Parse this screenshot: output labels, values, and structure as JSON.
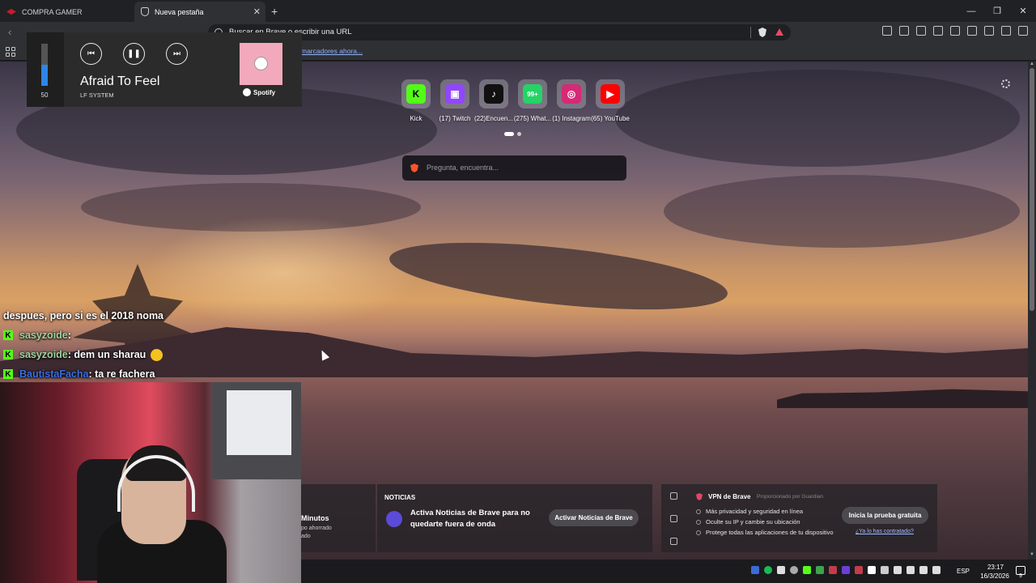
{
  "tabs": [
    {
      "label": "COMPRA GAMER",
      "icon": "compragamer-favicon"
    },
    {
      "label": "Nueva pestaña",
      "icon": "shield-favicon",
      "active": true
    }
  ],
  "toolbar": {
    "address_placeholder": "Buscar en Brave o escribir una URL"
  },
  "bookmarks": {
    "import_link": "marcadores ahora..."
  },
  "shortcuts": [
    {
      "label": "Kick",
      "icon": "kick-icon",
      "glyph": "K",
      "bg": "#53fc18",
      "fg": "#000000"
    },
    {
      "label": "(17) Twitch",
      "icon": "twitch-icon",
      "glyph": "▣",
      "bg": "#9146ff",
      "fg": "#ffffff"
    },
    {
      "label": "(22)Encuen...",
      "icon": "tiktok-icon",
      "glyph": "♪",
      "bg": "#111111",
      "fg": "#ffffff"
    },
    {
      "label": "(275) What...",
      "icon": "whatsapp-icon",
      "glyph": "99+",
      "bg": "#25d366",
      "fg": "#ffffff"
    },
    {
      "label": "(1) Instagram",
      "icon": "instagram-icon",
      "glyph": "◎",
      "bg": "#d62976",
      "fg": "#ffffff"
    },
    {
      "label": "(65) YouTube",
      "icon": "youtube-icon",
      "glyph": "▶",
      "bg": "#ff0000",
      "fg": "#ffffff"
    }
  ],
  "ask": {
    "placeholder": "Pregunta, encuentra..."
  },
  "media": {
    "volume": "50",
    "volume_level": 0.5,
    "song": "Afraid To Feel",
    "artist": "LF SYSTEM",
    "app": "Spotify"
  },
  "chat": [
    {
      "user": "",
      "message": "despues, pero si es el 2018 noma"
    },
    {
      "user": "sasyzoide",
      "message": " : "
    },
    {
      "user": "sasyzoide",
      "message": " : dem un sharau"
    },
    {
      "user": "BautistaFacha",
      "message": " : ta re fachera"
    }
  ],
  "stats": {
    "title": "Minutos",
    "line1": "po ahorrado",
    "line2": "ado"
  },
  "news": {
    "heading": "NOTICIAS",
    "text": "Activa Noticias de Brave para no quedarte fuera de onda",
    "button": "Activar Noticias de Brave"
  },
  "vpn": {
    "title": "VPN de Brave",
    "provided_by": "Proporcionado por",
    "provider": "Guardian",
    "items": [
      "Más privacidad y seguridad en línea",
      "Oculte su IP y cambie su ubicación",
      "Protege todas las aplicaciones de tu dispositivo"
    ],
    "button": "Inicia la prueba gratuita",
    "link": "¿Ya lo has contratado?"
  },
  "taskbar": {
    "language": "ESP",
    "time": "23:17",
    "date": "16/3/2026",
    "notifications": "9"
  },
  "colors": {
    "accent_brave": "#fb542b",
    "kick_green": "#53fc18"
  }
}
